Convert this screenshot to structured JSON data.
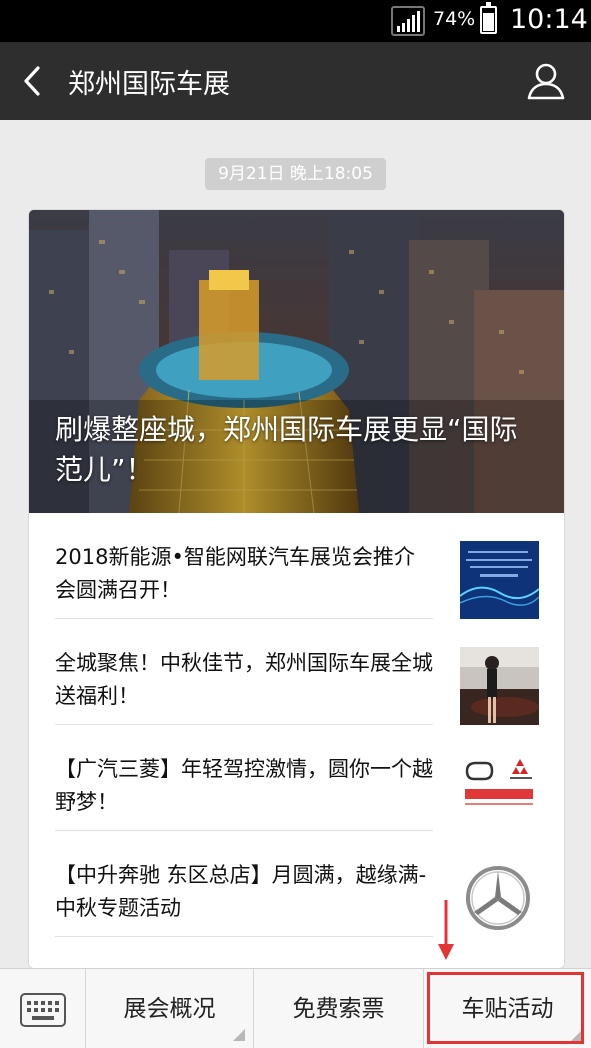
{
  "status_bar": {
    "battery": "74%",
    "time": "10:14"
  },
  "header": {
    "title": "郑州国际车展"
  },
  "timestamp": "9月21日 晚上18:05",
  "article": {
    "cover_title": "刷爆整座城，郑州国际车展更显“国际范儿”！",
    "items": [
      {
        "title": "2018新能源•智能网联汽车展览会推介会圆满召开！",
        "thumb": "event-poster-image"
      },
      {
        "title": "全城聚焦！中秋佳节，郑州国际车展全城送福利！",
        "thumb": "auto-show-model-image"
      },
      {
        "title": "【广汽三菱】年轻驾控激情，圆你一个越野梦！",
        "thumb": "gac-mitsubishi-logo"
      },
      {
        "title": "【中升奔驰 东区总店】月圆满，越缘满-中秋专题活动",
        "thumb": "mercedes-benz-logo"
      }
    ]
  },
  "menu": {
    "items": [
      {
        "label": "展会概况"
      },
      {
        "label": "免费索票"
      },
      {
        "label": "车贴活动"
      }
    ]
  },
  "colors": {
    "accent_red": "#e23434",
    "titlebar": "#2e2e2e",
    "background": "#ebebeb"
  }
}
